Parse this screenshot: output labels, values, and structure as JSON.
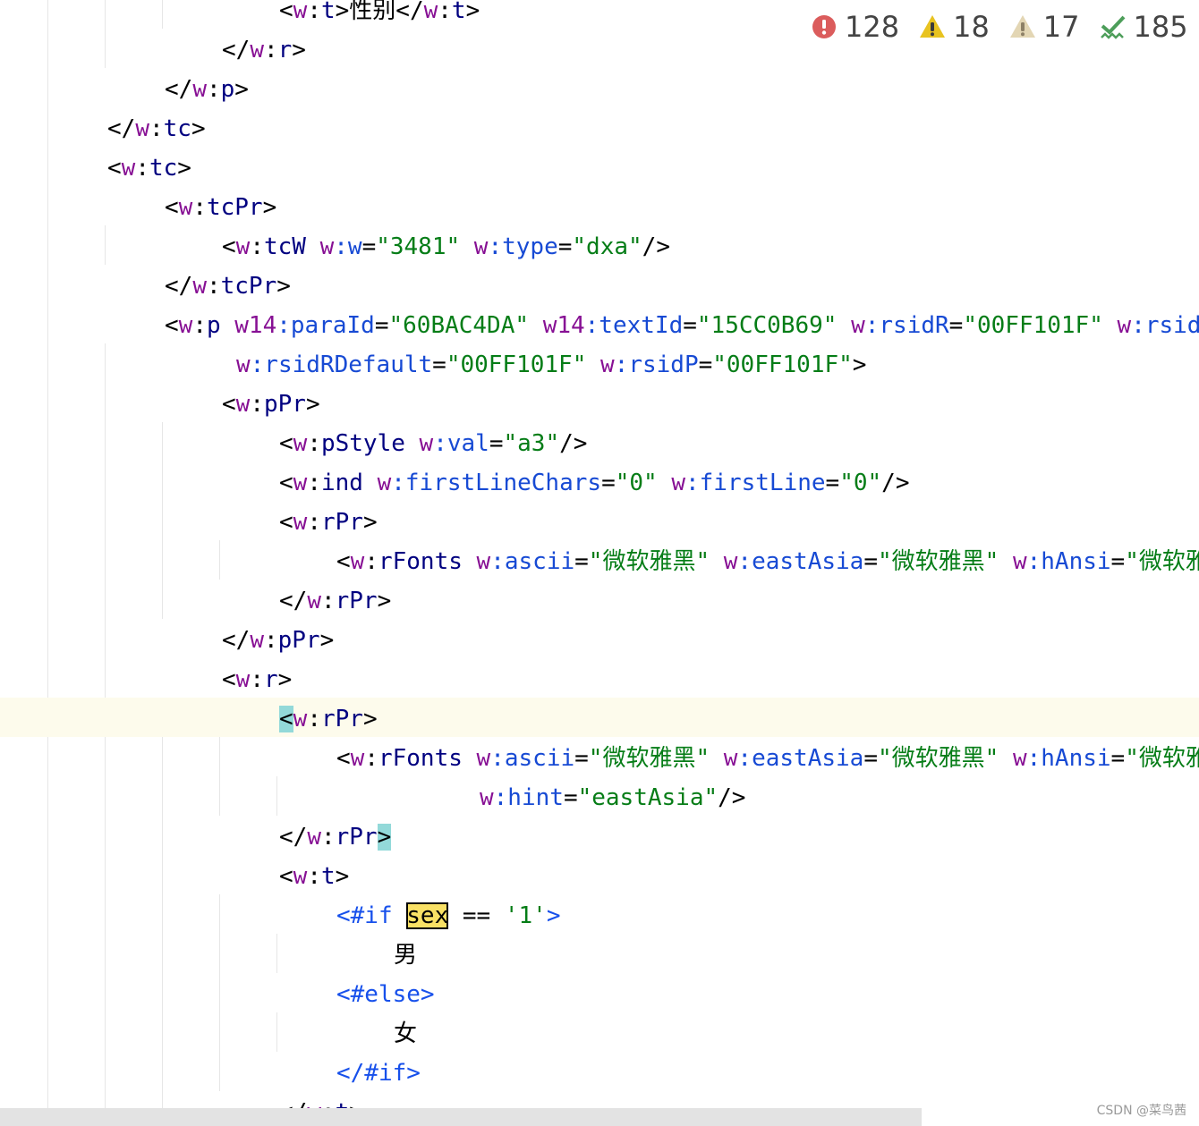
{
  "inspections": {
    "errors": {
      "icon": "error-icon",
      "count": "128"
    },
    "warnings": {
      "icon": "warning-icon",
      "count": "18"
    },
    "weak_warnings": {
      "icon": "weak-warning-icon",
      "count": "17"
    },
    "typos": {
      "icon": "typo-check-icon",
      "count": "185"
    }
  },
  "editor": {
    "lines": [
      {
        "indent": 4,
        "tokens": [
          [
            "p",
            "<"
          ],
          [
            "ns",
            "w"
          ],
          [
            "p",
            ":"
          ],
          [
            "t",
            "t"
          ],
          [
            "p",
            ">"
          ],
          [
            "cjk",
            "性别"
          ],
          [
            "p",
            "</"
          ],
          [
            "ns",
            "w"
          ],
          [
            "p",
            ":"
          ],
          [
            "t",
            "t"
          ],
          [
            "p",
            ">"
          ]
        ]
      },
      {
        "indent": 3,
        "tokens": [
          [
            "p",
            "</"
          ],
          [
            "ns",
            "w"
          ],
          [
            "p",
            ":"
          ],
          [
            "t",
            "r"
          ],
          [
            "p",
            ">"
          ]
        ]
      },
      {
        "indent": 2,
        "tokens": [
          [
            "p",
            "</"
          ],
          [
            "ns",
            "w"
          ],
          [
            "p",
            ":"
          ],
          [
            "t",
            "p"
          ],
          [
            "p",
            ">"
          ]
        ]
      },
      {
        "indent": 1,
        "tokens": [
          [
            "p",
            "</"
          ],
          [
            "ns",
            "w"
          ],
          [
            "p",
            ":"
          ],
          [
            "t",
            "tc"
          ],
          [
            "p",
            ">"
          ]
        ]
      },
      {
        "indent": 1,
        "tokens": [
          [
            "p",
            "<"
          ],
          [
            "ns",
            "w"
          ],
          [
            "p",
            ":"
          ],
          [
            "t",
            "tc"
          ],
          [
            "p",
            ">"
          ]
        ]
      },
      {
        "indent": 2,
        "tokens": [
          [
            "p",
            "<"
          ],
          [
            "ns",
            "w"
          ],
          [
            "p",
            ":"
          ],
          [
            "t",
            "tcPr"
          ],
          [
            "p",
            ">"
          ]
        ]
      },
      {
        "indent": 3,
        "tokens": [
          [
            "p",
            "<"
          ],
          [
            "ns",
            "w"
          ],
          [
            "p",
            ":"
          ],
          [
            "t",
            "tcW"
          ],
          [
            "p",
            " "
          ],
          [
            "ns",
            "w"
          ],
          [
            "a",
            ":w"
          ],
          [
            "p",
            "="
          ],
          [
            "v",
            "\"3481\""
          ],
          [
            "p",
            " "
          ],
          [
            "ns",
            "w"
          ],
          [
            "a",
            ":type"
          ],
          [
            "p",
            "="
          ],
          [
            "v",
            "\"dxa\""
          ],
          [
            "p",
            "/>"
          ]
        ]
      },
      {
        "indent": 2,
        "tokens": [
          [
            "p",
            "</"
          ],
          [
            "ns",
            "w"
          ],
          [
            "p",
            ":"
          ],
          [
            "t",
            "tcPr"
          ],
          [
            "p",
            ">"
          ]
        ]
      },
      {
        "indent": 2,
        "tokens": [
          [
            "p",
            "<"
          ],
          [
            "ns",
            "w"
          ],
          [
            "p",
            ":"
          ],
          [
            "t",
            "p"
          ],
          [
            "p",
            " "
          ],
          [
            "ns",
            "w14"
          ],
          [
            "a",
            ":paraId"
          ],
          [
            "p",
            "="
          ],
          [
            "v",
            "\"60BAC4DA\""
          ],
          [
            "p",
            " "
          ],
          [
            "ns",
            "w14"
          ],
          [
            "a",
            ":textId"
          ],
          [
            "p",
            "="
          ],
          [
            "v",
            "\"15CC0B69\""
          ],
          [
            "p",
            " "
          ],
          [
            "ns",
            "w"
          ],
          [
            "a",
            ":rsidR"
          ],
          [
            "p",
            "="
          ],
          [
            "v",
            "\"00FF101F\""
          ],
          [
            "p",
            " "
          ],
          [
            "ns",
            "w"
          ],
          [
            "a",
            ":rsidRPr"
          ]
        ]
      },
      {
        "indent": 2,
        "pad": 5,
        "tokens": [
          [
            "ns",
            "w"
          ],
          [
            "a",
            ":rsidRDefault"
          ],
          [
            "p",
            "="
          ],
          [
            "v",
            "\"00FF101F\""
          ],
          [
            "p",
            " "
          ],
          [
            "ns",
            "w"
          ],
          [
            "a",
            ":rsidP"
          ],
          [
            "p",
            "="
          ],
          [
            "v",
            "\"00FF101F\""
          ],
          [
            "p",
            ">"
          ]
        ]
      },
      {
        "indent": 3,
        "tokens": [
          [
            "p",
            "<"
          ],
          [
            "ns",
            "w"
          ],
          [
            "p",
            ":"
          ],
          [
            "t",
            "pPr"
          ],
          [
            "p",
            ">"
          ]
        ]
      },
      {
        "indent": 4,
        "tokens": [
          [
            "p",
            "<"
          ],
          [
            "ns",
            "w"
          ],
          [
            "p",
            ":"
          ],
          [
            "t",
            "pStyle"
          ],
          [
            "p",
            " "
          ],
          [
            "ns",
            "w"
          ],
          [
            "a",
            ":val"
          ],
          [
            "p",
            "="
          ],
          [
            "v",
            "\"a3\""
          ],
          [
            "p",
            "/>"
          ]
        ]
      },
      {
        "indent": 4,
        "tokens": [
          [
            "p",
            "<"
          ],
          [
            "ns",
            "w"
          ],
          [
            "p",
            ":"
          ],
          [
            "t",
            "ind"
          ],
          [
            "p",
            " "
          ],
          [
            "ns",
            "w"
          ],
          [
            "a",
            ":firstLineChars"
          ],
          [
            "p",
            "="
          ],
          [
            "v",
            "\"0\""
          ],
          [
            "p",
            " "
          ],
          [
            "ns",
            "w"
          ],
          [
            "a",
            ":firstLine"
          ],
          [
            "p",
            "="
          ],
          [
            "v",
            "\"0\""
          ],
          [
            "p",
            "/>"
          ]
        ]
      },
      {
        "indent": 4,
        "tokens": [
          [
            "p",
            "<"
          ],
          [
            "ns",
            "w"
          ],
          [
            "p",
            ":"
          ],
          [
            "t",
            "rPr"
          ],
          [
            "p",
            ">"
          ]
        ]
      },
      {
        "indent": 5,
        "tokens": [
          [
            "p",
            "<"
          ],
          [
            "ns",
            "w"
          ],
          [
            "p",
            ":"
          ],
          [
            "t",
            "rFonts"
          ],
          [
            "p",
            " "
          ],
          [
            "ns",
            "w"
          ],
          [
            "a",
            ":ascii"
          ],
          [
            "p",
            "="
          ],
          [
            "v",
            "\""
          ],
          [
            "cjkv",
            "微软雅黑"
          ],
          [
            "v",
            "\""
          ],
          [
            "p",
            " "
          ],
          [
            "ns",
            "w"
          ],
          [
            "a",
            ":eastAsia"
          ],
          [
            "p",
            "="
          ],
          [
            "v",
            "\""
          ],
          [
            "cjkv",
            "微软雅黑"
          ],
          [
            "v",
            "\""
          ],
          [
            "p",
            " "
          ],
          [
            "ns",
            "w"
          ],
          [
            "a",
            ":hAnsi"
          ],
          [
            "p",
            "="
          ],
          [
            "v",
            "\""
          ],
          [
            "cjkv",
            "微软雅黑"
          ],
          [
            "v",
            "\""
          ]
        ]
      },
      {
        "indent": 4,
        "tokens": [
          [
            "p",
            "</"
          ],
          [
            "ns",
            "w"
          ],
          [
            "p",
            ":"
          ],
          [
            "t",
            "rPr"
          ],
          [
            "p",
            ">"
          ]
        ]
      },
      {
        "indent": 3,
        "tokens": [
          [
            "p",
            "</"
          ],
          [
            "ns",
            "w"
          ],
          [
            "p",
            ":"
          ],
          [
            "t",
            "pPr"
          ],
          [
            "p",
            ">"
          ]
        ]
      },
      {
        "indent": 3,
        "tokens": [
          [
            "p",
            "<"
          ],
          [
            "ns",
            "w"
          ],
          [
            "p",
            ":"
          ],
          [
            "t",
            "r"
          ],
          [
            "p",
            ">"
          ]
        ]
      },
      {
        "indent": 4,
        "current": true,
        "tokens": [
          [
            "brace",
            "<"
          ],
          [
            "ns",
            "w"
          ],
          [
            "p",
            ":"
          ],
          [
            "t",
            "rPr"
          ],
          [
            "p",
            ">"
          ]
        ]
      },
      {
        "indent": 5,
        "tokens": [
          [
            "p",
            "<"
          ],
          [
            "ns",
            "w"
          ],
          [
            "p",
            ":"
          ],
          [
            "t",
            "rFonts"
          ],
          [
            "p",
            " "
          ],
          [
            "ns",
            "w"
          ],
          [
            "a",
            ":ascii"
          ],
          [
            "p",
            "="
          ],
          [
            "v",
            "\""
          ],
          [
            "cjkv",
            "微软雅黑"
          ],
          [
            "v",
            "\""
          ],
          [
            "p",
            " "
          ],
          [
            "ns",
            "w"
          ],
          [
            "a",
            ":eastAsia"
          ],
          [
            "p",
            "="
          ],
          [
            "v",
            "\""
          ],
          [
            "cjkv",
            "微软雅黑"
          ],
          [
            "v",
            "\""
          ],
          [
            "p",
            " "
          ],
          [
            "ns",
            "w"
          ],
          [
            "a",
            ":hAnsi"
          ],
          [
            "p",
            "="
          ],
          [
            "v",
            "\""
          ],
          [
            "cjkv",
            "微软雅黑"
          ],
          [
            "v",
            "\""
          ]
        ]
      },
      {
        "indent": 5,
        "pad": 10,
        "tokens": [
          [
            "ns",
            "w"
          ],
          [
            "a",
            ":hint"
          ],
          [
            "p",
            "="
          ],
          [
            "v",
            "\"eastAsia\""
          ],
          [
            "p",
            "/>"
          ]
        ]
      },
      {
        "indent": 4,
        "tokens": [
          [
            "p",
            "</"
          ],
          [
            "ns",
            "w"
          ],
          [
            "p",
            ":"
          ],
          [
            "t",
            "rPr"
          ],
          [
            "brace",
            ">"
          ]
        ]
      },
      {
        "indent": 4,
        "tokens": [
          [
            "p",
            "<"
          ],
          [
            "ns",
            "w"
          ],
          [
            "p",
            ":"
          ],
          [
            "t",
            "t"
          ],
          [
            "p",
            ">"
          ]
        ]
      },
      {
        "indent": 5,
        "tokens": [
          [
            "c",
            "<#if "
          ],
          [
            "ident",
            "sex"
          ],
          [
            "p",
            " == "
          ],
          [
            "v",
            "'1'"
          ],
          [
            "c",
            ">"
          ]
        ]
      },
      {
        "indent": 6,
        "tokens": [
          [
            "cjk",
            "男"
          ]
        ]
      },
      {
        "indent": 5,
        "tokens": [
          [
            "c",
            "<#else>"
          ]
        ]
      },
      {
        "indent": 6,
        "tokens": [
          [
            "cjk",
            "女"
          ]
        ]
      },
      {
        "indent": 5,
        "tokens": [
          [
            "c",
            "</#if>"
          ]
        ]
      },
      {
        "indent": 4,
        "tokens": [
          [
            "p",
            "</"
          ],
          [
            "ns",
            "w"
          ],
          [
            "p",
            ":"
          ],
          [
            "t",
            "t"
          ],
          [
            "p",
            ">"
          ]
        ]
      }
    ]
  },
  "watermark": "CSDN @菜鸟茜"
}
